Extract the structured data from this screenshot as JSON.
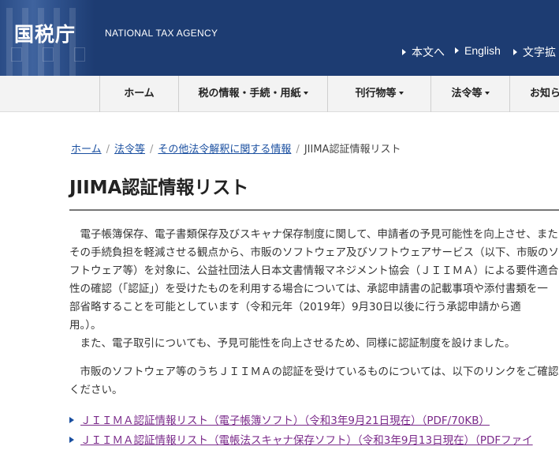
{
  "header": {
    "logo_jp": "国税庁",
    "logo_en": "NATIONAL TAX AGENCY",
    "util_links": [
      {
        "label": "本文へ"
      },
      {
        "label": "English"
      },
      {
        "label": "文字拡"
      }
    ]
  },
  "nav": {
    "items": [
      {
        "label": "ホーム"
      },
      {
        "label": "税の情報・手続・用紙"
      },
      {
        "label": "刊行物等"
      },
      {
        "label": "法令等"
      },
      {
        "label": "お知ら"
      }
    ]
  },
  "breadcrumb": {
    "items": [
      {
        "label": "ホーム"
      },
      {
        "label": "法令等"
      },
      {
        "label": "その他法令解釈に関する情報"
      }
    ],
    "current": "JIIMA認証情報リスト"
  },
  "page": {
    "title": "JIIMA認証情報リスト",
    "para1": [
      "　電子帳簿保存、電子書類保存及びスキャナ保存制度に関して、申請者の予見可能性を向上させ、また",
      "その手続負担を軽減させる観点から、市販のソフトウェア及びソフトウェアサービス（以下、市販のソ",
      "フトウェア等）を対象に、公益社団法人日本文書情報マネジメント協会（ＪＩＩＭＡ）による要件適合",
      "性の確認（「認証」）を受けたものを利用する場合については、承認申請書の記載事項や添付書類を一",
      "部省略することを可能としています（令和元年（2019年）9月30日以後に行う承認申請から適",
      "用。）。"
    ],
    "para2": "　また、電子取引についても、予見可能性を向上させるため、同様に認証制度を設けました。",
    "para3": [
      "　市販のソフトウェア等のうちＪＩＩＭＡの認証を受けているものについては、以下のリンクをご確認",
      "ください。"
    ],
    "links": [
      {
        "label": "ＪＩＩＭＡ認証情報リスト（電子帳簿ソフト）（令和3年9月21日現在）（PDF/70KB）"
      },
      {
        "label": "ＪＩＩＭＡ認証情報リスト（電帳法スキャナ保存ソフト）（令和3年9月13日現在）（PDFファイ"
      }
    ]
  }
}
